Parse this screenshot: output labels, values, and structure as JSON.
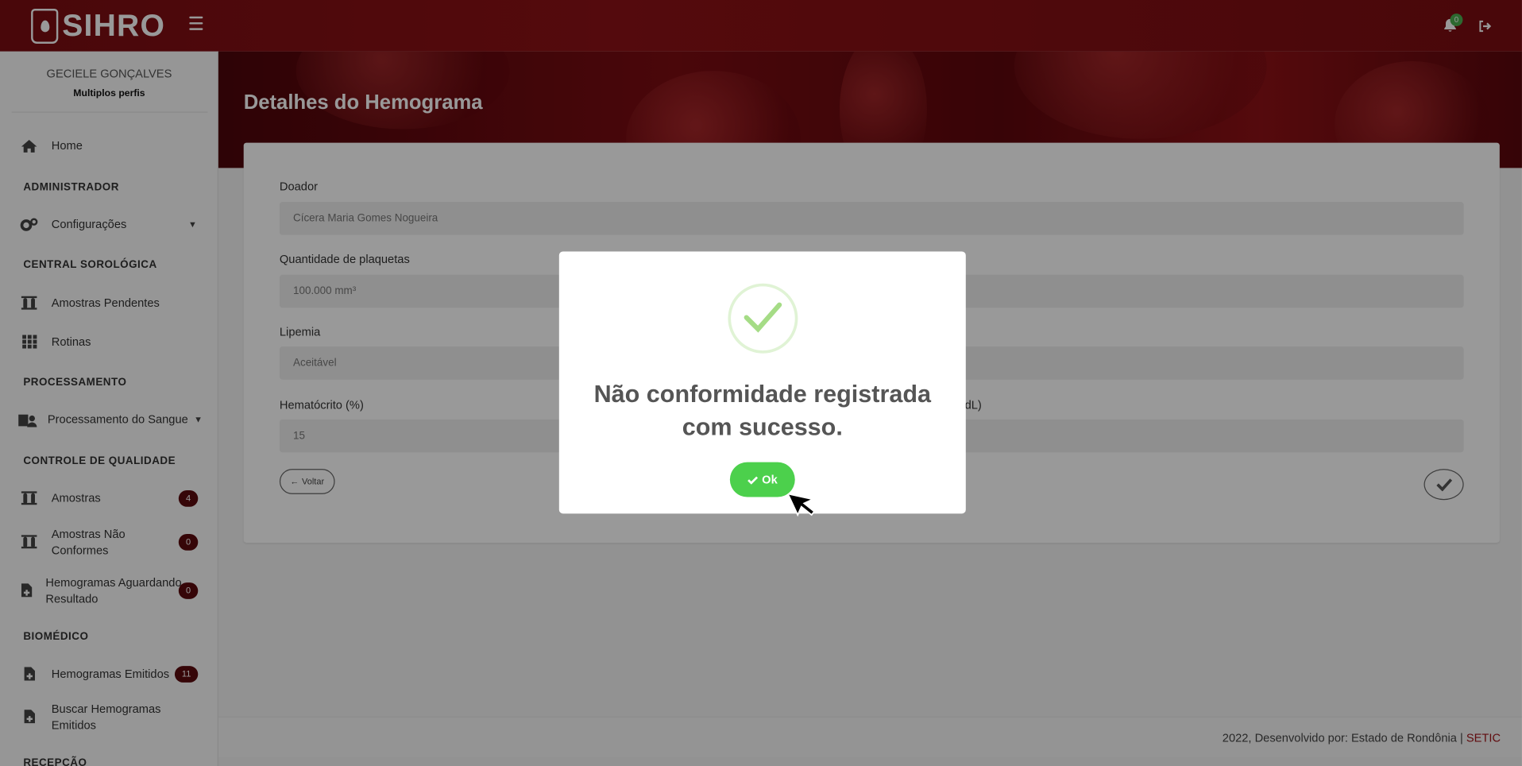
{
  "app": {
    "name": "SIHRO"
  },
  "header": {
    "notification_count": "0"
  },
  "user": {
    "name": "GECIELE GONÇALVES",
    "profile": "Multiplos perfis"
  },
  "sidebar": {
    "home": "Home",
    "section_admin": "ADMINISTRADOR",
    "configuracoes": "Configurações",
    "section_central": "CENTRAL SOROLÓGICA",
    "amostras_pendentes": "Amostras Pendentes",
    "rotinas": "Rotinas",
    "section_processamento": "PROCESSAMENTO",
    "processamento_sangue": "Processamento do Sangue",
    "section_qualidade": "CONTROLE DE QUALIDADE",
    "amostras": "Amostras",
    "amostras_badge": "4",
    "amostras_nao_conformes_1": "Amostras Não",
    "amostras_nao_conformes_2": "Conformes",
    "amostras_nao_conformes_badge": "0",
    "hemogramas_aguardando_1": "Hemogramas Aguardando",
    "hemogramas_aguardando_2": "Resultado",
    "hemogramas_aguardando_badge": "0",
    "section_biomedico": "BIOMÉDICO",
    "hemogramas_emitidos": "Hemogramas Emitidos",
    "hemogramas_emitidos_badge": "11",
    "buscar_hemogramas_1": "Buscar Hemogramas",
    "buscar_hemogramas_2": "Emitidos",
    "section_recepcao": "RECEPÇÃO"
  },
  "page": {
    "title": "Detalhes do Hemograma",
    "fields": {
      "doador_label": "Doador",
      "doador_value": "Cícera Maria Gomes Nogueira",
      "plaquetas_label": "Quantidade de plaquetas",
      "plaquetas_value": "100.000 mm³",
      "lipemia_label": "Lipemia",
      "lipemia_value": "Aceitável",
      "hematocrito_label": "Hematócrito (%)",
      "hematocrito_value": "15",
      "right_label_partial": "dL)"
    },
    "voltar_label": "Voltar"
  },
  "modal": {
    "message_line1": "Não conformidade registrada",
    "message_line2": "com sucesso.",
    "ok_label": "Ok"
  },
  "footer": {
    "text": "2022, Desenvolvido por: Estado de Rondônia | ",
    "link": "SETIC"
  }
}
